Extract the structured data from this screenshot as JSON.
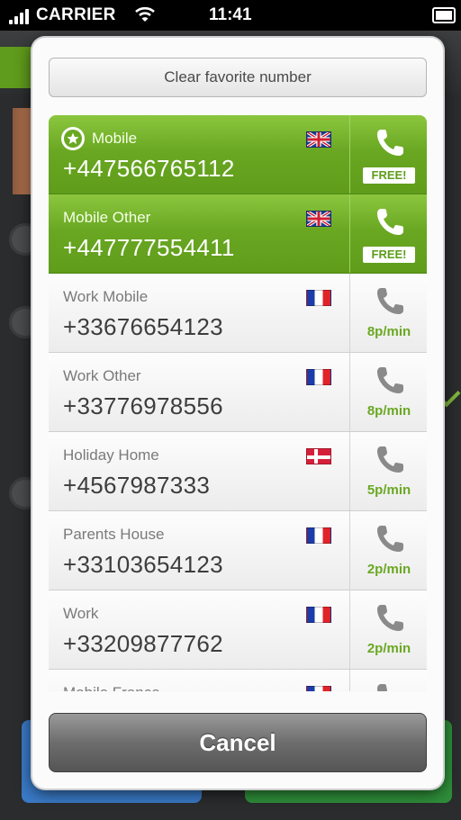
{
  "status_bar": {
    "carrier": "CARRIER",
    "time": "11:41"
  },
  "dialog": {
    "clear_button_label": "Clear favorite number",
    "cancel_button_label": "Cancel",
    "numbers": [
      {
        "label": "Mobile",
        "number": "+447566765112",
        "flag": "gb",
        "rate": "FREE!",
        "highlighted": true,
        "favorite": true
      },
      {
        "label": "Mobile Other",
        "number": "+447777554411",
        "flag": "gb",
        "rate": "FREE!",
        "highlighted": true,
        "favorite": false
      },
      {
        "label": "Work Mobile",
        "number": "+33676654123",
        "flag": "fr",
        "rate": "8p/min",
        "highlighted": false,
        "favorite": false
      },
      {
        "label": "Work Other",
        "number": "+33776978556",
        "flag": "fr",
        "rate": "8p/min",
        "highlighted": false,
        "favorite": false
      },
      {
        "label": "Holiday Home",
        "number": "+4567987333",
        "flag": "dk",
        "rate": "5p/min",
        "highlighted": false,
        "favorite": false
      },
      {
        "label": "Parents House",
        "number": "+33103654123",
        "flag": "fr",
        "rate": "2p/min",
        "highlighted": false,
        "favorite": false
      },
      {
        "label": "Work",
        "number": "+33209877762",
        "flag": "fr",
        "rate": "2p/min",
        "highlighted": false,
        "favorite": false
      },
      {
        "label": "Mobile France",
        "number": "",
        "flag": "fr",
        "rate": "",
        "highlighted": false,
        "favorite": false
      }
    ]
  },
  "colors": {
    "accent_green": "#6aa823",
    "rate_green": "#6aa823"
  },
  "icons": {
    "call": "phone-icon",
    "favorite": "star-icon"
  }
}
